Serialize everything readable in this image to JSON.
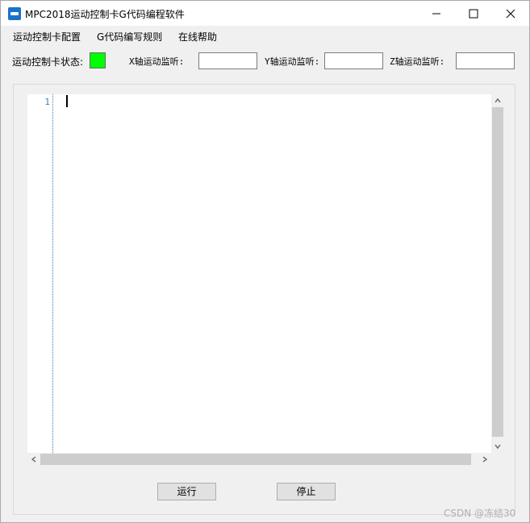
{
  "window": {
    "title": "MPC2018运动控制卡G代码编程软件",
    "controls": [
      "minimize-icon",
      "maximize-icon",
      "close-icon"
    ]
  },
  "menu": {
    "items": [
      {
        "label": "运动控制卡配置"
      },
      {
        "label": "G代码编写规则"
      },
      {
        "label": "在线帮助"
      }
    ]
  },
  "status": {
    "card_status_label": "运动控制卡状态:",
    "card_status_color": "#00ff00",
    "x_monitor_label": "X轴运动监听:",
    "y_monitor_label": "Y轴运动监听:",
    "z_monitor_label": "Z轴运动监听:",
    "x_monitor_value": "",
    "y_monitor_value": "",
    "z_monitor_value": ""
  },
  "editor": {
    "line_numbers": [
      "1"
    ],
    "content": ""
  },
  "buttons": {
    "run_label": "运行",
    "stop_label": "停止"
  },
  "watermark": "CSDN @冻结30"
}
